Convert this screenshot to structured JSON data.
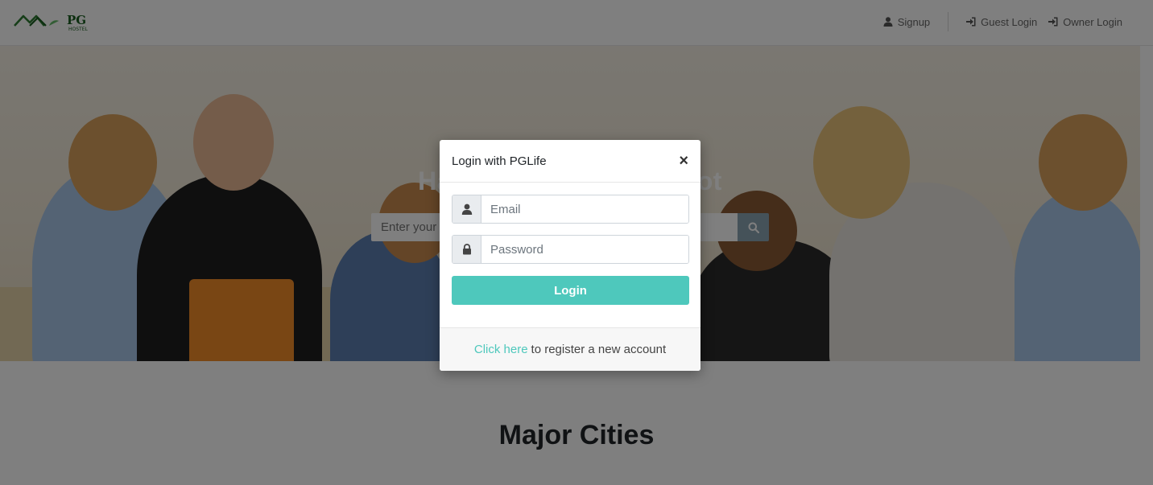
{
  "brand": {
    "logo_text": "PG",
    "logo_subtext": "HOSTEL",
    "accent": "#2e7d32"
  },
  "nav": {
    "signup_label": "Signup",
    "guest_login_label": "Guest Login",
    "owner_login_label": "Owner Login",
    "signup_icon": "user-icon",
    "login_icon": "sign-in-icon"
  },
  "hero": {
    "title": "Happy Hunting Your Pot",
    "search_placeholder": "Enter your city to search for PGs",
    "search_icon": "search-icon"
  },
  "cities": {
    "title": "Major Cities"
  },
  "modal": {
    "title": "Login with PGLife",
    "close_symbol": "×",
    "email_placeholder": "Email",
    "password_placeholder": "Password",
    "login_label": "Login",
    "footer_link": "Click here",
    "footer_text": "to register a new account",
    "accent": "#4ec8bc"
  }
}
